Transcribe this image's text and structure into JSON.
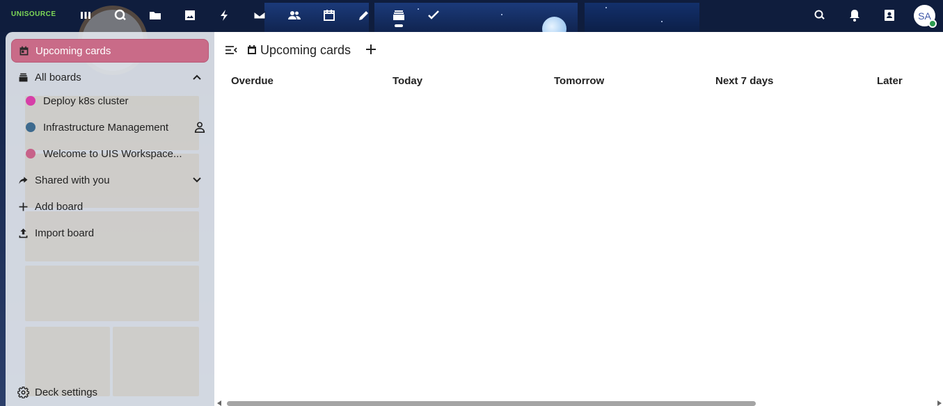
{
  "app": {
    "logo_text": "UNISOURCE",
    "user_initials": "SA",
    "accent_color": "#c96b88"
  },
  "topbar": {
    "apps": [
      {
        "name": "dashboard",
        "icon": "dashboard-icon"
      },
      {
        "name": "search",
        "icon": "magnifier-icon"
      },
      {
        "name": "files",
        "icon": "folder-icon"
      },
      {
        "name": "photos",
        "icon": "image-icon"
      },
      {
        "name": "activity",
        "icon": "lightning-icon"
      },
      {
        "name": "mail",
        "icon": "mail-icon"
      },
      {
        "name": "contacts",
        "icon": "people-icon"
      },
      {
        "name": "calendar",
        "icon": "calendar-icon"
      },
      {
        "name": "notes",
        "icon": "pencil-icon"
      },
      {
        "name": "deck",
        "icon": "deck-icon"
      },
      {
        "name": "tasks",
        "icon": "checkmark-icon"
      }
    ],
    "right_icons": [
      "search-icon",
      "bell-icon",
      "contacts-menu-icon"
    ]
  },
  "sidebar": {
    "upcoming_label": "Upcoming cards",
    "all_boards_label": "All boards",
    "boards": [
      {
        "label": "Deploy k8s cluster",
        "color": "#d63fa8",
        "shared": false
      },
      {
        "label": "Infrastructure Management",
        "color": "#3d6a8e",
        "shared": true
      },
      {
        "label": "Welcome to UIS Workspace...",
        "color": "#c7628a",
        "shared": false
      }
    ],
    "shared_label": "Shared with you",
    "add_board_label": "Add board",
    "import_board_label": "Import board",
    "settings_label": "Deck settings"
  },
  "main": {
    "title": "Upcoming cards",
    "columns": [
      "Overdue",
      "Today",
      "Tomorrow",
      "Next 7 days",
      "Later"
    ]
  }
}
